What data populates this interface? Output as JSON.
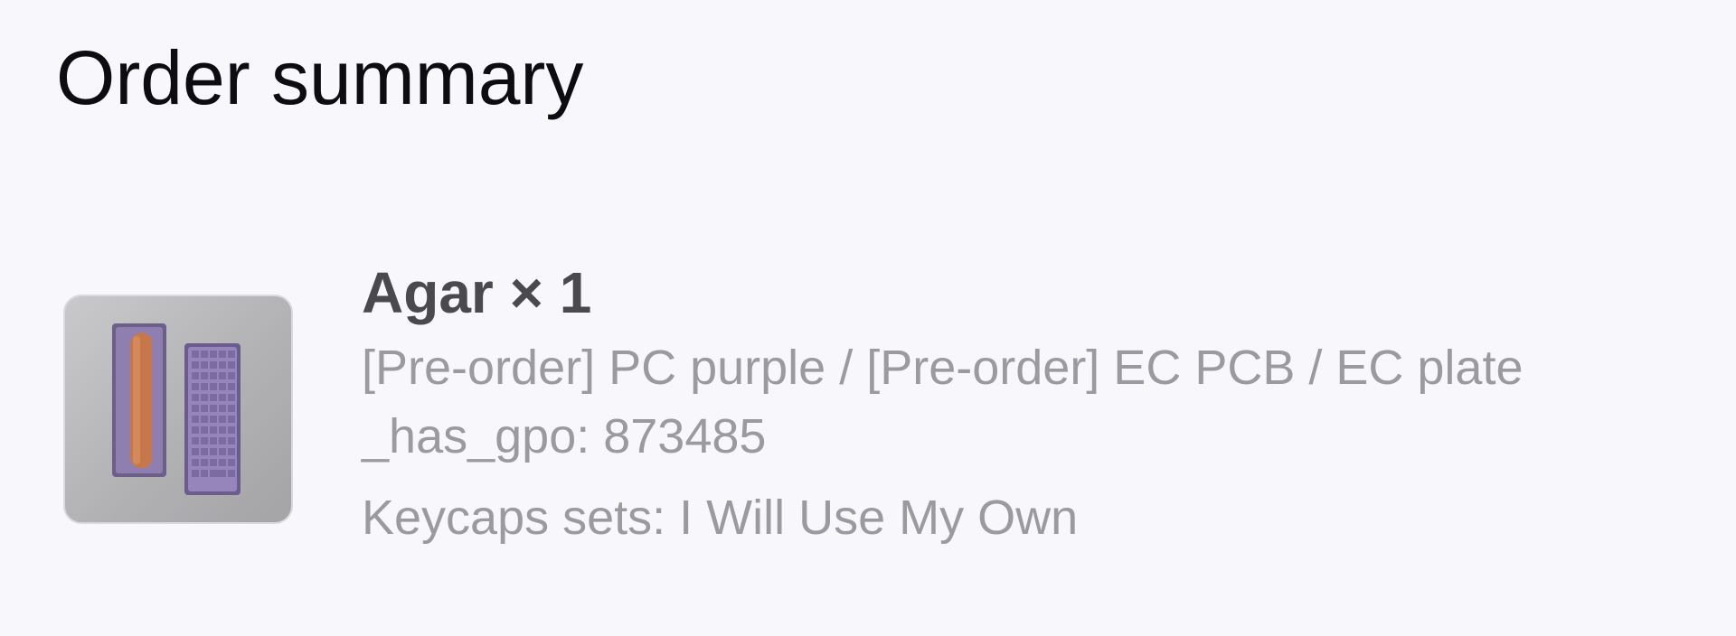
{
  "heading": "Order summary",
  "line_item": {
    "title": "Agar × 1",
    "variant": "[Pre-order] PC purple / [Pre-order] EC PCB / EC plate",
    "gpo": "_has_gpo: 873485",
    "property": "Keycaps sets: I Will Use My Own",
    "thumbnail_icon": "keyboard-product-image"
  },
  "colors": {
    "background": "#f8f8fc",
    "heading": "#0d0d10",
    "item_title": "#4a4a4e",
    "secondary_text": "#9a9a9f",
    "case_purple": "#8f7fb0",
    "wrist_rest": "#c6784a"
  }
}
